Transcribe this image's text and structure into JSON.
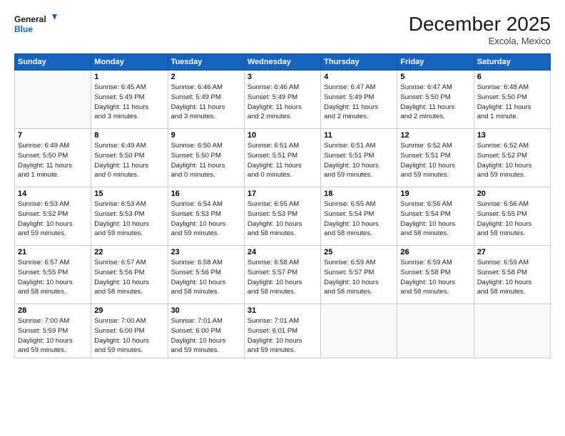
{
  "logo": {
    "general": "General",
    "blue": "Blue"
  },
  "title": "December 2025",
  "location": "Excola, Mexico",
  "days_header": [
    "Sunday",
    "Monday",
    "Tuesday",
    "Wednesday",
    "Thursday",
    "Friday",
    "Saturday"
  ],
  "weeks": [
    [
      {
        "num": "",
        "info": ""
      },
      {
        "num": "1",
        "info": "Sunrise: 6:45 AM\nSunset: 5:49 PM\nDaylight: 11 hours\nand 3 minutes."
      },
      {
        "num": "2",
        "info": "Sunrise: 6:46 AM\nSunset: 5:49 PM\nDaylight: 11 hours\nand 3 minutes."
      },
      {
        "num": "3",
        "info": "Sunrise: 6:46 AM\nSunset: 5:49 PM\nDaylight: 11 hours\nand 2 minutes."
      },
      {
        "num": "4",
        "info": "Sunrise: 6:47 AM\nSunset: 5:49 PM\nDaylight: 11 hours\nand 2 minutes."
      },
      {
        "num": "5",
        "info": "Sunrise: 6:47 AM\nSunset: 5:50 PM\nDaylight: 11 hours\nand 2 minutes."
      },
      {
        "num": "6",
        "info": "Sunrise: 6:48 AM\nSunset: 5:50 PM\nDaylight: 11 hours\nand 1 minute."
      }
    ],
    [
      {
        "num": "7",
        "info": "Sunrise: 6:49 AM\nSunset: 5:50 PM\nDaylight: 11 hours\nand 1 minute."
      },
      {
        "num": "8",
        "info": "Sunrise: 6:49 AM\nSunset: 5:50 PM\nDaylight: 11 hours\nand 0 minutes."
      },
      {
        "num": "9",
        "info": "Sunrise: 6:50 AM\nSunset: 5:50 PM\nDaylight: 11 hours\nand 0 minutes."
      },
      {
        "num": "10",
        "info": "Sunrise: 6:51 AM\nSunset: 5:51 PM\nDaylight: 11 hours\nand 0 minutes."
      },
      {
        "num": "11",
        "info": "Sunrise: 6:51 AM\nSunset: 5:51 PM\nDaylight: 10 hours\nand 59 minutes."
      },
      {
        "num": "12",
        "info": "Sunrise: 6:52 AM\nSunset: 5:51 PM\nDaylight: 10 hours\nand 59 minutes."
      },
      {
        "num": "13",
        "info": "Sunrise: 6:52 AM\nSunset: 5:52 PM\nDaylight: 10 hours\nand 59 minutes."
      }
    ],
    [
      {
        "num": "14",
        "info": "Sunrise: 6:53 AM\nSunset: 5:52 PM\nDaylight: 10 hours\nand 59 minutes."
      },
      {
        "num": "15",
        "info": "Sunrise: 6:53 AM\nSunset: 5:53 PM\nDaylight: 10 hours\nand 59 minutes."
      },
      {
        "num": "16",
        "info": "Sunrise: 6:54 AM\nSunset: 5:53 PM\nDaylight: 10 hours\nand 59 minutes."
      },
      {
        "num": "17",
        "info": "Sunrise: 6:55 AM\nSunset: 5:53 PM\nDaylight: 10 hours\nand 58 minutes."
      },
      {
        "num": "18",
        "info": "Sunrise: 6:55 AM\nSunset: 5:54 PM\nDaylight: 10 hours\nand 58 minutes."
      },
      {
        "num": "19",
        "info": "Sunrise: 6:56 AM\nSunset: 5:54 PM\nDaylight: 10 hours\nand 58 minutes."
      },
      {
        "num": "20",
        "info": "Sunrise: 6:56 AM\nSunset: 5:55 PM\nDaylight: 10 hours\nand 58 minutes."
      }
    ],
    [
      {
        "num": "21",
        "info": "Sunrise: 6:57 AM\nSunset: 5:55 PM\nDaylight: 10 hours\nand 58 minutes."
      },
      {
        "num": "22",
        "info": "Sunrise: 6:57 AM\nSunset: 5:56 PM\nDaylight: 10 hours\nand 58 minutes."
      },
      {
        "num": "23",
        "info": "Sunrise: 6:58 AM\nSunset: 5:56 PM\nDaylight: 10 hours\nand 58 minutes."
      },
      {
        "num": "24",
        "info": "Sunrise: 6:58 AM\nSunset: 5:57 PM\nDaylight: 10 hours\nand 58 minutes."
      },
      {
        "num": "25",
        "info": "Sunrise: 6:59 AM\nSunset: 5:57 PM\nDaylight: 10 hours\nand 58 minutes."
      },
      {
        "num": "26",
        "info": "Sunrise: 6:59 AM\nSunset: 5:58 PM\nDaylight: 10 hours\nand 58 minutes."
      },
      {
        "num": "27",
        "info": "Sunrise: 6:59 AM\nSunset: 5:58 PM\nDaylight: 10 hours\nand 58 minutes."
      }
    ],
    [
      {
        "num": "28",
        "info": "Sunrise: 7:00 AM\nSunset: 5:59 PM\nDaylight: 10 hours\nand 59 minutes."
      },
      {
        "num": "29",
        "info": "Sunrise: 7:00 AM\nSunset: 6:00 PM\nDaylight: 10 hours\nand 59 minutes."
      },
      {
        "num": "30",
        "info": "Sunrise: 7:01 AM\nSunset: 6:00 PM\nDaylight: 10 hours\nand 59 minutes."
      },
      {
        "num": "31",
        "info": "Sunrise: 7:01 AM\nSunset: 6:01 PM\nDaylight: 10 hours\nand 59 minutes."
      },
      {
        "num": "",
        "info": ""
      },
      {
        "num": "",
        "info": ""
      },
      {
        "num": "",
        "info": ""
      }
    ]
  ]
}
